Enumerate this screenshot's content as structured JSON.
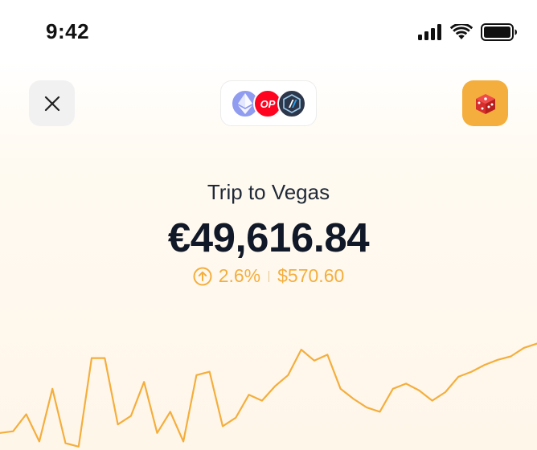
{
  "status": {
    "time": "9:42"
  },
  "header": {
    "networks": [
      {
        "name": "ethereum-icon"
      },
      {
        "name": "optimism-icon",
        "label": "OP"
      },
      {
        "name": "arbitrum-icon"
      }
    ],
    "avatar_icon": "dice-icon"
  },
  "wallet": {
    "name": "Trip to Vegas",
    "balance": "€49,616.84",
    "change_percent": "2.6%",
    "change_value": "$570.60"
  },
  "colors": {
    "accent": "#f4ae3d",
    "text": "#111827",
    "op_red": "#ff0420",
    "eth_blue": "#8f9cf0",
    "arb_navy": "#2d374b"
  },
  "chart_data": {
    "type": "line",
    "values": [
      20,
      22,
      42,
      10,
      72,
      8,
      4,
      108,
      108,
      30,
      40,
      80,
      20,
      45,
      10,
      88,
      92,
      28,
      38,
      65,
      58,
      75,
      88,
      118,
      105,
      112,
      72,
      60,
      50,
      45,
      72,
      78,
      70,
      58,
      68,
      86,
      92,
      100,
      106,
      110,
      120,
      125
    ],
    "ylim": [
      0,
      170
    ],
    "grid": false
  }
}
